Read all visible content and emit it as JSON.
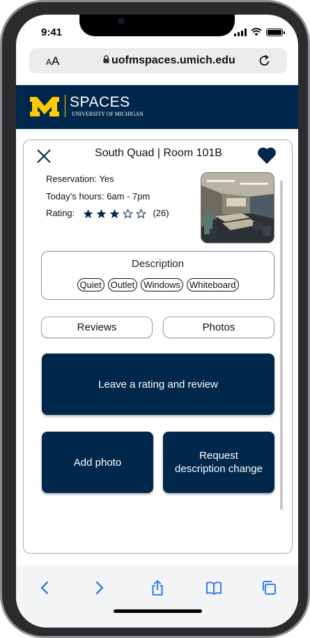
{
  "status": {
    "time": "9:41"
  },
  "browser": {
    "text_size_label_small": "A",
    "text_size_label_large": "A",
    "url": "uofmspaces.umich.edu"
  },
  "brand": {
    "title": "SPACES",
    "subtitle": "UNIVERSITY OF MICHIGAN",
    "accent_color": "#ffcb05",
    "primary_color": "#00274c"
  },
  "room": {
    "title": "South Quad | Room 101B",
    "reservation": "Reservation: Yes",
    "hours": "Today’s hours: 6am - 7pm",
    "rating_label": "Rating:",
    "rating_value": 3,
    "rating_max": 5,
    "rating_count": "(26)",
    "favorited": true
  },
  "description": {
    "title": "Description",
    "tags": [
      "Quiet",
      "Outlet",
      "Windows",
      "Whiteboard"
    ]
  },
  "tabs": {
    "reviews": "Reviews",
    "photos": "Photos"
  },
  "actions": {
    "leave_review": "Leave a rating and review",
    "add_photo": "Add photo",
    "request_change_line1": "Request",
    "request_change_line2": "description change"
  },
  "toolbar": {
    "icons": [
      "back-icon",
      "forward-icon",
      "share-icon",
      "bookmarks-icon",
      "tabs-icon"
    ],
    "icon_color": "#1a73e8"
  }
}
